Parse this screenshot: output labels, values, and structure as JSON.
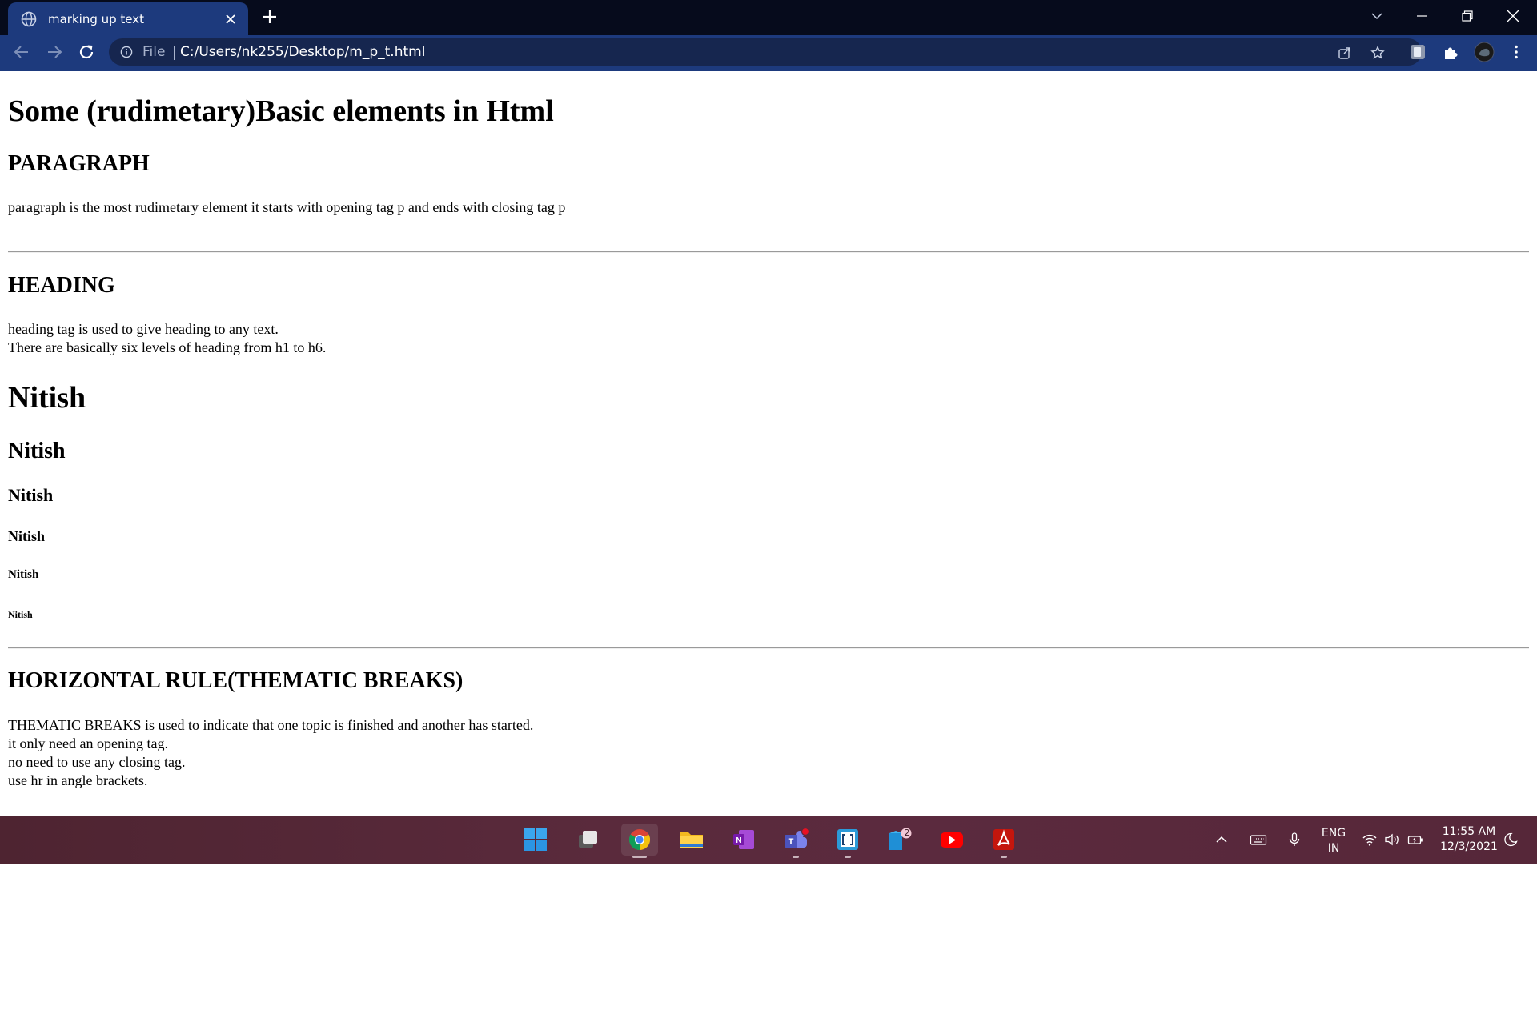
{
  "browser": {
    "tab_title": "marking up text",
    "url_scheme": "File",
    "url": "C:/Users/nk255/Desktop/m_p_t.html"
  },
  "page": {
    "title": "Some (rudimetary)Basic elements in Html",
    "paragraph_section": {
      "heading": "PARAGRAPH",
      "text": "paragraph is the most rudimetary element it starts with opening tag p and ends with closing tag p"
    },
    "heading_section": {
      "heading": "HEADING",
      "lines": [
        "heading tag is used to give heading to any text.",
        "There are basically six levels of heading from h1 to h6."
      ],
      "samples": [
        "Nitish",
        "Nitish",
        "Nitish",
        "Nitish",
        "Nitish",
        "Nitish"
      ]
    },
    "hr_section": {
      "heading": "HORIZONTAL RULE(THEMATIC BREAKS)",
      "lines": [
        "THEMATIC BREAKS is used to indicate that one topic is finished and another has started.",
        "it only need an opening tag.",
        "no need to use any closing tag.",
        "use hr in angle brackets."
      ]
    }
  },
  "taskbar": {
    "apps": [
      "start",
      "task-view",
      "chrome",
      "file-explorer",
      "onenote",
      "teams",
      "terminal",
      "store",
      "youtube",
      "acrobat"
    ],
    "store_badge": "2",
    "language": "ENG",
    "region": "IN",
    "time": "11:55 AM",
    "date": "12/3/2021"
  },
  "colors": {
    "tab_strip": "#060b1c",
    "toolbar": "#1d3a7d",
    "omnibox": "#16264f",
    "taskbar": "#5a2a3c"
  }
}
